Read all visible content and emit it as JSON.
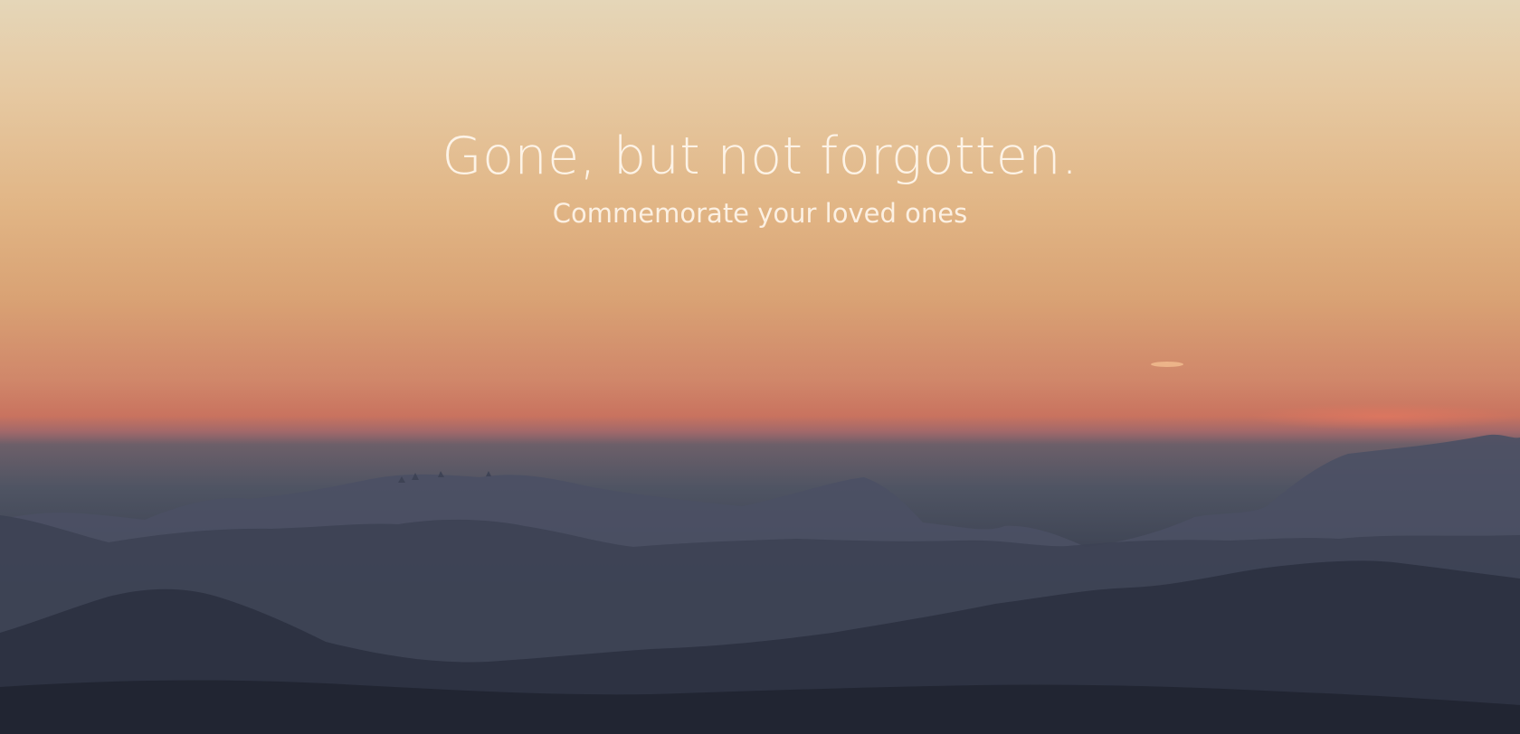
{
  "hero": {
    "title": "Gone, but not forgotten.",
    "subtitle": "Commemorate your loved ones"
  },
  "colors": {
    "sky_top": "#e5d6b8",
    "sky_mid": "#e1b585",
    "horizon": "#c9735f",
    "mountains_far": "#4a4f62",
    "mountains_near": "#232836",
    "text": "#fff7ee"
  }
}
